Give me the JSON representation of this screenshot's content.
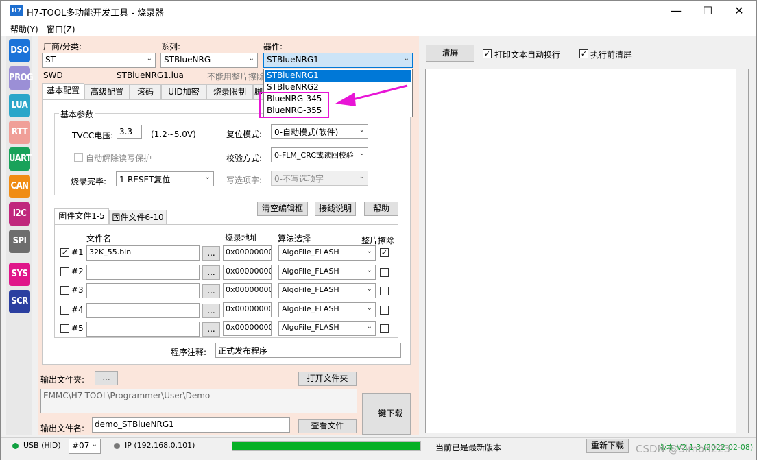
{
  "window": {
    "icon_text": "H7",
    "title": "H7-TOOL多功能开发工具 - 烧录器",
    "minimize": "—",
    "maximize": "☐",
    "close": "✕"
  },
  "menu": [
    "帮助(Y)",
    "窗口(Z)"
  ],
  "sidebar": [
    {
      "label": "DSO",
      "color": "#1a73d9"
    },
    {
      "label": "PROG",
      "color": "#9b8fd6"
    },
    {
      "label": "LUA",
      "color": "#2aa6c9"
    },
    {
      "label": "RTT",
      "color": "#f09f98"
    },
    {
      "label": "UART",
      "color": "#19a25a"
    },
    {
      "label": "CAN",
      "color": "#f08c13"
    },
    {
      "label": "I2C",
      "color": "#c0277d"
    },
    {
      "label": "SPI",
      "color": "#6d6d6d"
    },
    {
      "label": "SYS",
      "color": "#e0168a"
    },
    {
      "label": "SCR",
      "color": "#2b3fa0"
    }
  ],
  "selectors": {
    "vendor_label": "厂商/分类:",
    "vendor_value": "ST",
    "series_label": "系列:",
    "series_value": "STBlueNRG",
    "device_label": "器件:",
    "device_value": "STBlueNRG1"
  },
  "info_row": {
    "interface": "SWD",
    "lua_file": "STBlueNRG1.lua",
    "note": "不能用整片擦除"
  },
  "device_dropdown": [
    "STBlueNRG1",
    "STBlueNRG2",
    "BlueNRG-345",
    "BlueNRG-355"
  ],
  "tabs": [
    "基本配置",
    "高级配置",
    "滚码",
    "UID加密",
    "烧录限制",
    "脚"
  ],
  "basic": {
    "group_title": "基本参数",
    "tvcc_label": "TVCC电压:",
    "tvcc_value": "3.3",
    "tvcc_range": "(1.2~5.0V)",
    "reset_label": "复位模式:",
    "reset_value": "0-自动模式(软件)",
    "auto_unlock_label": "自动解除读写保护",
    "verify_label": "校验方式:",
    "verify_value": "0-FLM_CRC或读回校验",
    "done_label": "烧录完毕:",
    "done_value": "1-RESET复位",
    "option_label": "写选项字:",
    "option_value": "0-不写选项字"
  },
  "buttons": {
    "clear_edit": "清空编辑框",
    "wiring": "接线说明",
    "help": "帮助",
    "browse_out": "...",
    "open_folder": "打开文件夹",
    "view_file": "查看文件",
    "one_key": "一键下载",
    "clear_screen": "清屏",
    "redownload": "重新下载"
  },
  "file_tabs": [
    "固件文件1-5",
    "固件文件6-10"
  ],
  "file_table": {
    "col_name": "文件名",
    "col_addr": "烧录地址",
    "col_algo": "算法选择",
    "col_erase": "整片擦除",
    "rows": [
      {
        "id": "#1",
        "checked": true,
        "file": "32K_55.bin",
        "browse": "...",
        "addr": "0x00000000",
        "algo": "AlgoFile_FLASH",
        "erase": true
      },
      {
        "id": "#2",
        "checked": false,
        "file": "",
        "browse": "...",
        "addr": "0x00000000",
        "algo": "AlgoFile_FLASH",
        "erase": false
      },
      {
        "id": "#3",
        "checked": false,
        "file": "",
        "browse": "...",
        "addr": "0x00000000",
        "algo": "AlgoFile_FLASH",
        "erase": false
      },
      {
        "id": "#4",
        "checked": false,
        "file": "",
        "browse": "...",
        "addr": "0x00000000",
        "algo": "AlgoFile_FLASH",
        "erase": false
      },
      {
        "id": "#5",
        "checked": false,
        "file": "",
        "browse": "...",
        "addr": "0x00000000",
        "algo": "AlgoFile_FLASH",
        "erase": false
      }
    ]
  },
  "comment": {
    "label": "程序注释:",
    "value": "正式发布程序"
  },
  "output": {
    "folder_label": "输出文件夹:",
    "folder_path": "EMMC\\H7-TOOL\\Programmer\\User\\Demo",
    "file_label": "输出文件名:",
    "file_value": "demo_STBlueNRG1"
  },
  "right": {
    "wrap_label": "打印文本自动换行",
    "clear_before_label": "执行前清屏"
  },
  "status": {
    "usb": "USB (HID)",
    "port": "#07",
    "ip": "IP (192.168.0.101)",
    "progress": 1.0,
    "message": "当前已是最新版本",
    "version": "版本:V2.1.3 (2022-02-08)",
    "watermark": "CSDN @Simon223"
  },
  "colors": {
    "accent": "#0078d7",
    "highlight": "#e815d6",
    "panel": "#fbe6dc",
    "progress": "#06b025"
  }
}
